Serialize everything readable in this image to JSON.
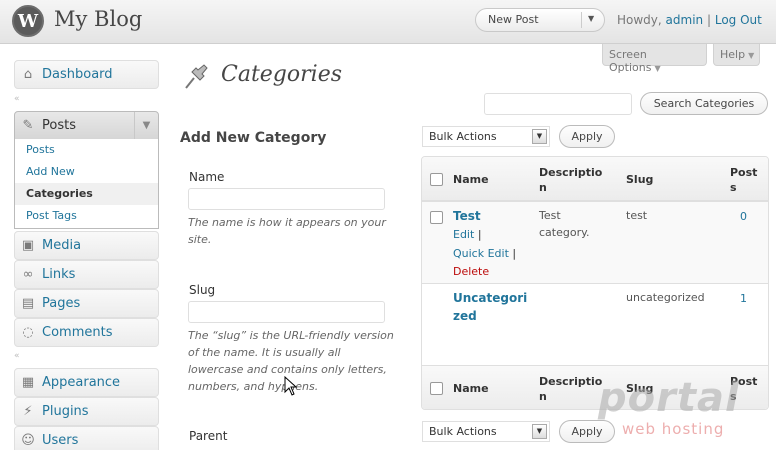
{
  "header": {
    "logo_letter": "W",
    "site_title": "My Blog",
    "favorite_action": "New Post",
    "howdy": "Howdy,",
    "username": "admin",
    "separator": "|",
    "logout": "Log Out"
  },
  "screen_meta": {
    "screen_options": "Screen Options",
    "help": "Help"
  },
  "sidebar": {
    "dashboard": "Dashboard",
    "posts": "Posts",
    "posts_submenu": [
      "Posts",
      "Add New",
      "Categories",
      "Post Tags"
    ],
    "media": "Media",
    "links": "Links",
    "pages": "Pages",
    "comments": "Comments",
    "appearance": "Appearance",
    "plugins": "Plugins",
    "users": "Users"
  },
  "page": {
    "title": "Categories",
    "search_button": "Search Categories",
    "search_value": ""
  },
  "form": {
    "heading": "Add New Category",
    "name_label": "Name",
    "name_value": "",
    "name_desc": "The name is how it appears on your site.",
    "slug_label": "Slug",
    "slug_value": "",
    "slug_desc": "The “slug” is the URL-friendly version of the name. It is usually all lowercase and contains only letters, numbers, and hyphens.",
    "parent_label": "Parent"
  },
  "bulk": {
    "selected": "Bulk Actions",
    "apply": "Apply"
  },
  "table": {
    "columns": {
      "name": "Name",
      "description_l1": "Descriptio",
      "description_l2": "n",
      "slug": "Slug",
      "posts_l1": "Post",
      "posts_l2": "s"
    },
    "rows": [
      {
        "name": "Test",
        "actions": {
          "edit": "Edit",
          "sep": "|",
          "quick_edit": "Quick Edit",
          "delete": "Delete"
        },
        "description_l1": "Test",
        "description_l2": "category.",
        "slug": "test",
        "count": "0"
      },
      {
        "name_l1": "Uncategori",
        "name_l2": "zed",
        "description": "",
        "slug": "uncategorized",
        "count": "1"
      }
    ]
  },
  "watermark": {
    "main": "portal",
    "sub": "web hosting"
  },
  "colors": {
    "link": "#21759b",
    "delete": "#bc0b0b",
    "header_bg": "#e4e4e4"
  }
}
